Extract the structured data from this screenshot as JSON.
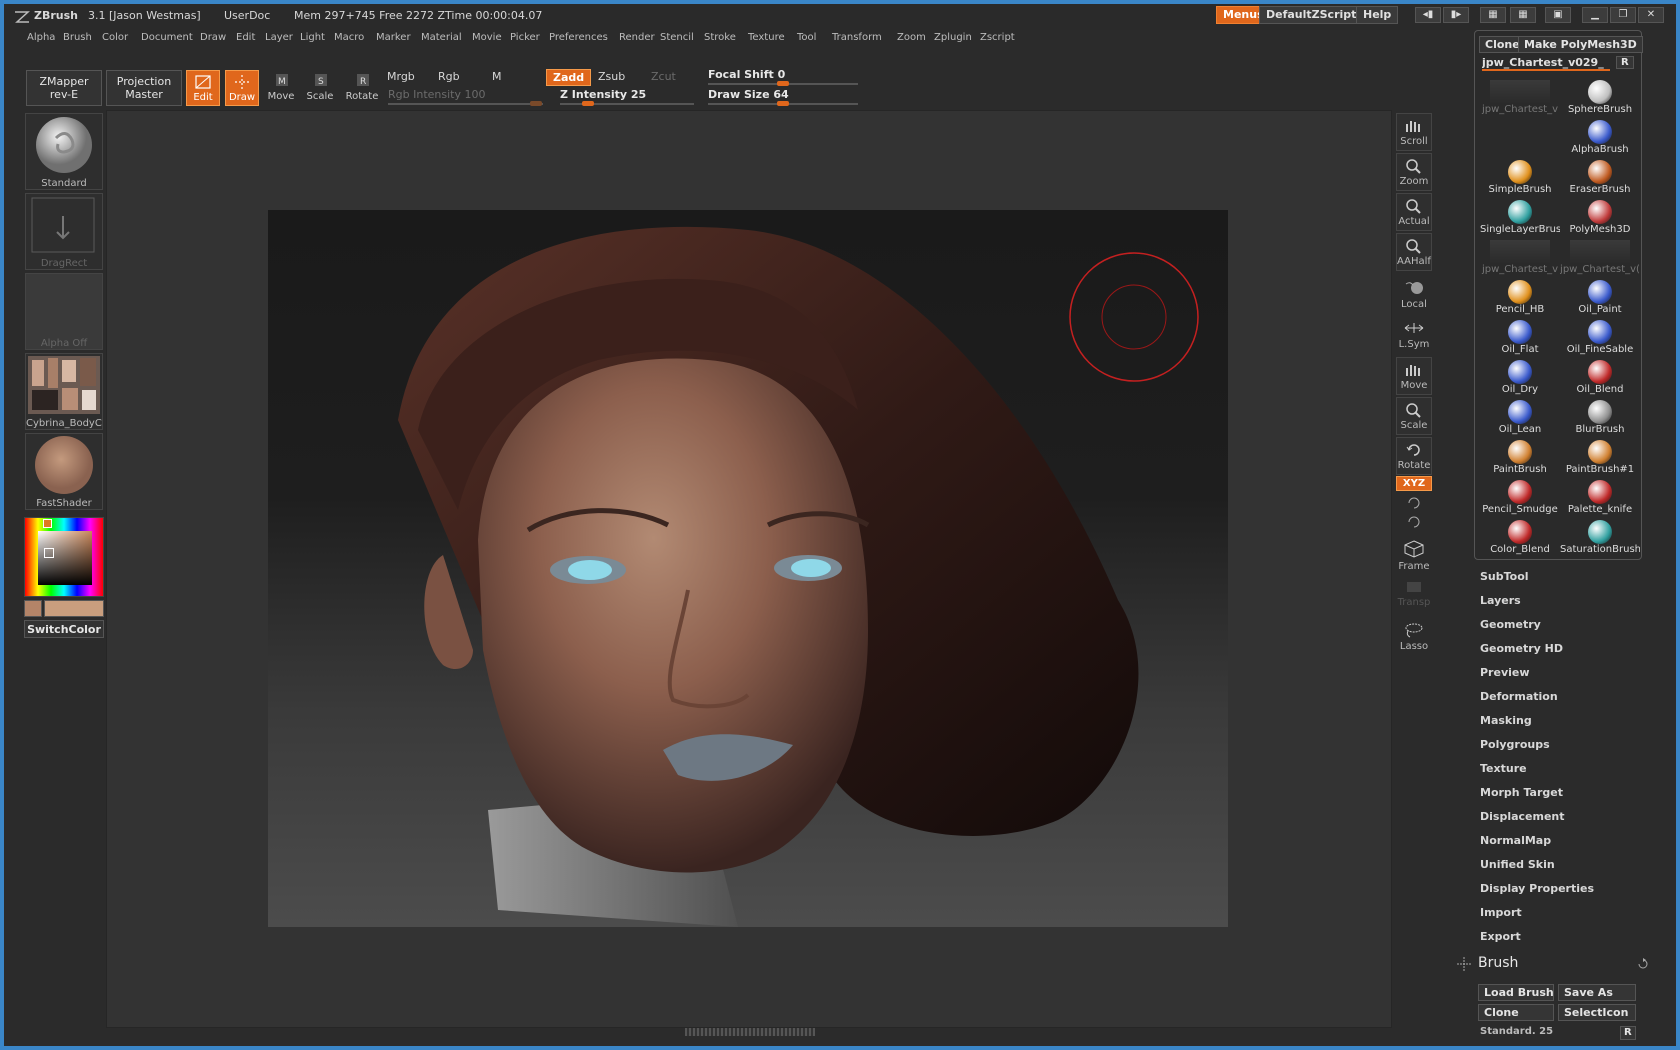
{
  "titlebar": {
    "app": "ZBrush",
    "version_user": "3.1 [Jason Westmas]",
    "doc": "UserDoc",
    "mem": "Mem 297+745  Free 2272  ZTime 00:00:04.07",
    "menus_btn": "Menus",
    "script_btn": "DefaultZScript",
    "help_btn": "Help"
  },
  "menubar": [
    "Alpha",
    "Brush",
    "Color",
    "Document",
    "Draw",
    "Edit",
    "Layer",
    "Light",
    "Macro",
    "Marker",
    "Material",
    "Movie",
    "Picker",
    "Preferences",
    "Render",
    "Stencil",
    "Stroke",
    "Texture",
    "Tool",
    "Transform",
    "Zoom",
    "Zplugin",
    "Zscript"
  ],
  "topshelf": {
    "zmapper": "ZMapper",
    "zmapper_sub": "rev-E",
    "projection": "Projection",
    "projection_sub": "Master",
    "edit": "Edit",
    "draw": "Draw",
    "move": "Move",
    "scale": "Scale",
    "rotate": "Rotate",
    "mrgb": "Mrgb",
    "rgb": "Rgb",
    "m": "M",
    "rgb_intensity": "Rgb  Intensity 100",
    "zadd": "Zadd",
    "zsub": "Zsub",
    "zcut": "Zcut",
    "z_intensity": "Z Intensity 25",
    "focal_shift": "Focal Shift 0",
    "draw_size": "Draw Size 64",
    "rgb_intensity_value": 100,
    "z_intensity_value": 25,
    "draw_size_value": 64
  },
  "leftcol": {
    "standard": "Standard",
    "dragrect": "DragRect",
    "alpha_off": "Alpha  Off",
    "texture": "Cybrina_BodyCol",
    "material": "FastShader",
    "switchcolor": "SwitchColor"
  },
  "rightbar": {
    "scroll": "Scroll",
    "zoom": "Zoom",
    "actual": "Actual",
    "aahalf": "AAHalf",
    "local": "Local",
    "lsym": "L.Sym",
    "move": "Move",
    "scale": "Scale",
    "rotate": "Rotate",
    "xyz": "XYZ",
    "frame": "Frame",
    "transp": "Transp",
    "lasso": "Lasso"
  },
  "palette": {
    "clone": "Clone",
    "make_polymesh": "Make PolyMesh3D",
    "tool_name": "jpw_Chartest_v029_",
    "r": "R",
    "brushes": [
      [
        "jpw_Chartest_v",
        "SphereBrush"
      ],
      [
        "",
        "AlphaBrush"
      ],
      [
        "SimpleBrush",
        "EraserBrush"
      ],
      [
        "SingleLayerBrush",
        "PolyMesh3D"
      ],
      [
        "jpw_Chartest_v",
        "jpw_Chartest_v("
      ],
      [
        "Pencil_HB",
        "Oil_Paint"
      ],
      [
        "Oil_Flat",
        "Oil_FineSable"
      ],
      [
        "Oil_Dry",
        "Oil_Blend"
      ],
      [
        "Oil_Lean",
        "BlurBrush"
      ],
      [
        "PaintBrush",
        "PaintBrush#1"
      ],
      [
        "Pencil_Smudge",
        "Palette_knife"
      ],
      [
        "Color_Blend",
        "SaturationBrush"
      ]
    ]
  },
  "submenus": [
    "SubTool",
    "Layers",
    "Geometry",
    "Geometry HD",
    "Preview",
    "Deformation",
    "Masking",
    "Polygroups",
    "Texture",
    "Morph Target",
    "Displacement",
    "NormalMap",
    "Unified Skin",
    "Display Properties",
    "Import",
    "Export"
  ],
  "brush_section": {
    "title": "Brush",
    "load": "Load Brush",
    "save_as": "Save As",
    "clone": "Clone",
    "select_icon": "SelectIcon",
    "current": "Standard. 25",
    "r": "R"
  },
  "colors": {
    "accent": "#e0671c",
    "frame": "#3a86c8",
    "background": "#2b2b2b"
  }
}
